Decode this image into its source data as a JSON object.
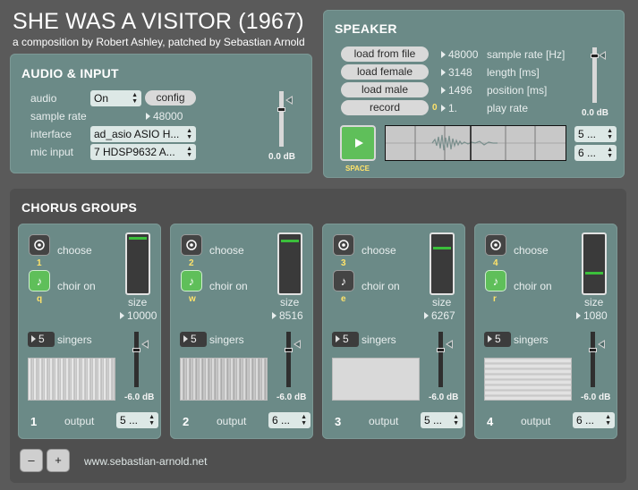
{
  "header": {
    "title": "SHE WAS A VISITOR (1967)",
    "subtitle": "a composition by Robert Ashley, patched by Sebastian Arnold"
  },
  "audio_input": {
    "title": "AUDIO & INPUT",
    "audio_label": "audio",
    "audio_value": "On",
    "config_label": "config",
    "sample_rate_label": "sample rate",
    "sample_rate_value": "48000",
    "interface_label": "interface",
    "interface_value": "ad_asio ASIO H...",
    "mic_input_label": "mic input",
    "mic_input_value": "7 HDSP9632 A...",
    "gain_db": "0.0 dB"
  },
  "speaker": {
    "title": "SPEAKER",
    "load_file_label": "load from file",
    "load_female_label": "load female",
    "load_male_label": "load male",
    "record_label": "record",
    "record_count": "0",
    "sample_rate_value": "48000",
    "sample_rate_label": "sample rate [Hz]",
    "length_value": "3148",
    "length_label": "length [ms]",
    "position_value": "1496",
    "position_label": "position [ms]",
    "play_rate_value": "1.",
    "play_rate_label": "play rate",
    "space_label": "SPACE",
    "gain_db": "0.0 dB",
    "output_a": "5 ...",
    "output_b": "6 ..."
  },
  "chorus": {
    "title": "CHORUS GROUPS",
    "groups": [
      {
        "number": "1",
        "choose_label": "choose",
        "choose_key": "1",
        "choir_label": "choir on",
        "choir_key": "q",
        "choir_on": true,
        "size_label": "size",
        "size_value": "10000",
        "singers_value": "5",
        "singers_label": "singers",
        "gain_db": "-6.0 dB",
        "output_label": "output",
        "output_value": "5 ..."
      },
      {
        "number": "2",
        "choose_label": "choose",
        "choose_key": "2",
        "choir_label": "choir on",
        "choir_key": "w",
        "choir_on": true,
        "size_label": "size",
        "size_value": "8516",
        "singers_value": "5",
        "singers_label": "singers",
        "gain_db": "-6.0 dB",
        "output_label": "output",
        "output_value": "6 ..."
      },
      {
        "number": "3",
        "choose_label": "choose",
        "choose_key": "3",
        "choir_label": "choir on",
        "choir_key": "e",
        "choir_on": false,
        "size_label": "size",
        "size_value": "6267",
        "singers_value": "5",
        "singers_label": "singers",
        "gain_db": "-6.0 dB",
        "output_label": "output",
        "output_value": "5 ..."
      },
      {
        "number": "4",
        "choose_label": "choose",
        "choose_key": "4",
        "choir_label": "choir on",
        "choir_key": "r",
        "choir_on": true,
        "size_label": "size",
        "size_value": "1080",
        "singers_value": "5",
        "singers_label": "singers",
        "gain_db": "-6.0 dB",
        "output_label": "output",
        "output_value": "6 ..."
      }
    ],
    "minus_label": "–",
    "plus_label": "+",
    "website": "www.sebastian-arnold.net"
  },
  "colors": {
    "panel": "#6b8a87",
    "accent_green": "#5fbf5a",
    "key_yellow": "#ffe36a"
  }
}
